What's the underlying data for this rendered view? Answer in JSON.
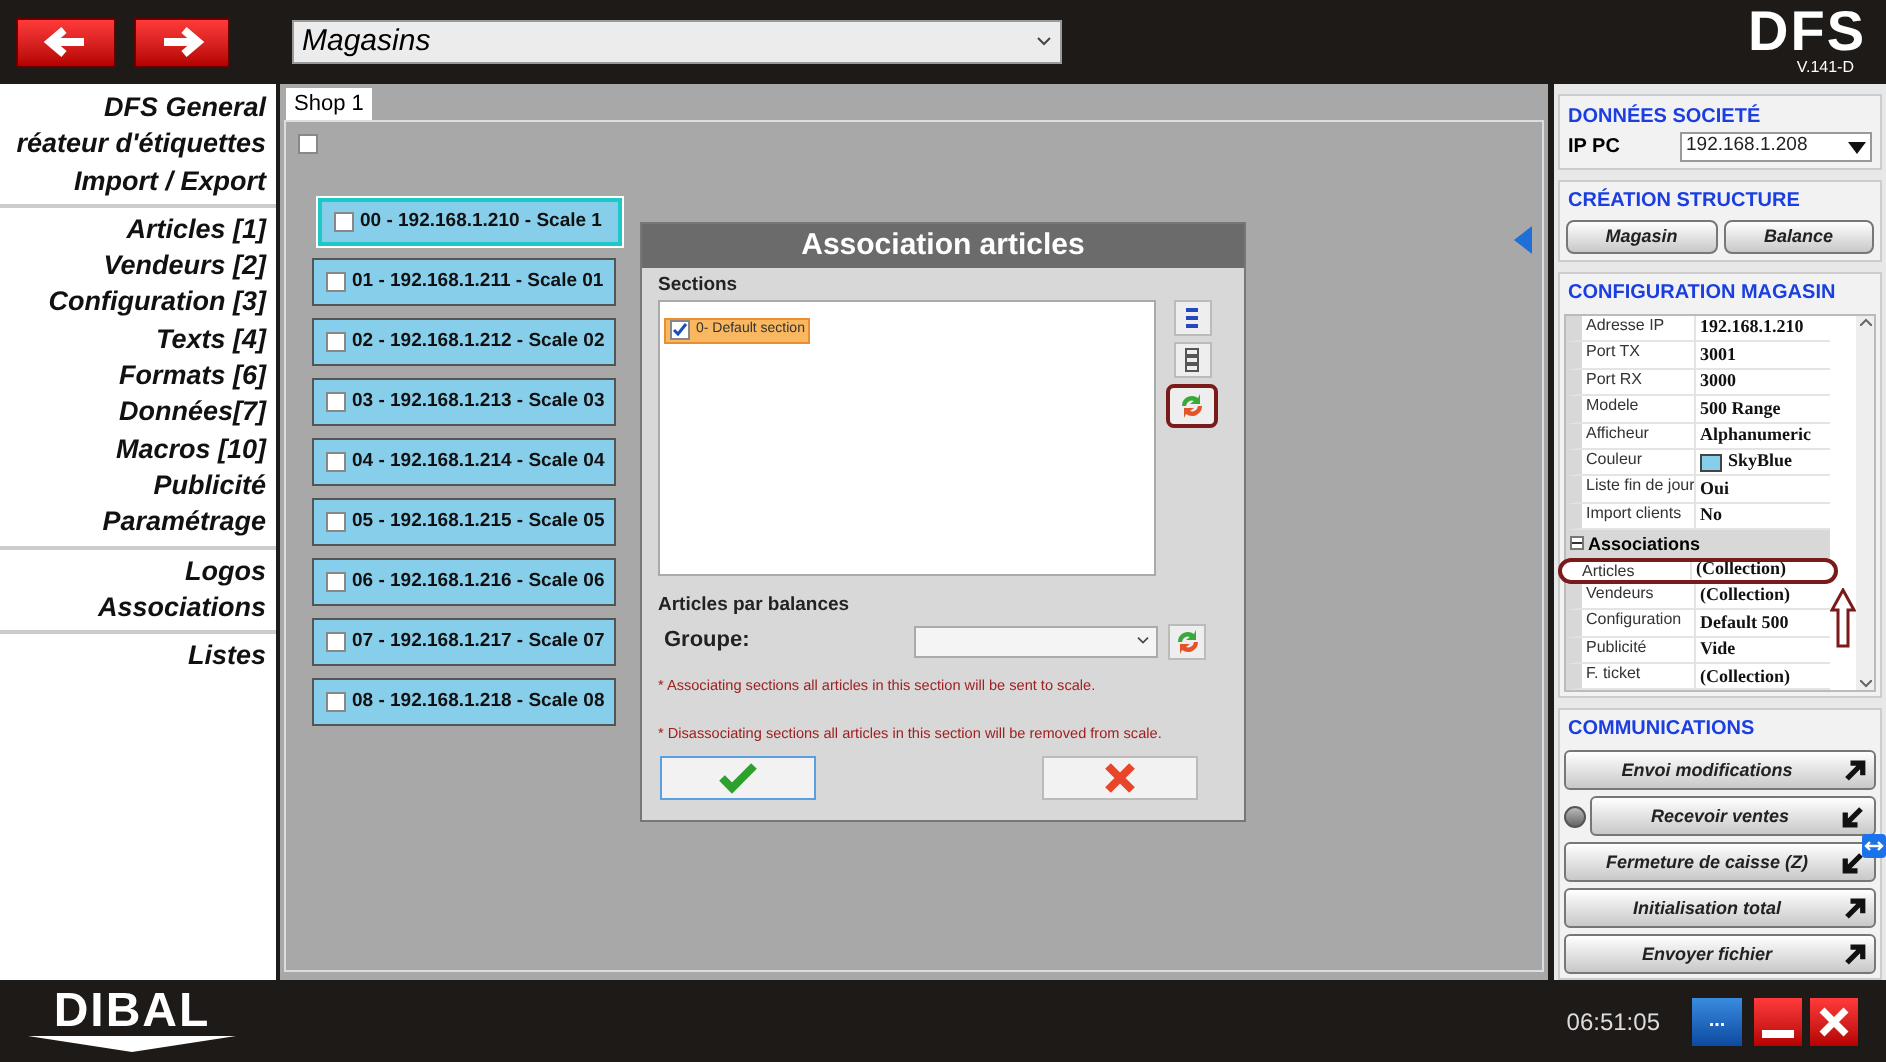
{
  "top_bar": {
    "store_select": {
      "value": "Magasins"
    },
    "logo": "DFS",
    "version": "V.141-D"
  },
  "sidebar": {
    "groups": [
      {
        "items": [
          "DFS General",
          "réateur d'étiquettes",
          "Import / Export"
        ]
      },
      {
        "items": [
          "Articles [1]",
          "Vendeurs [2]",
          "Configuration [3]",
          "Texts [4]",
          "Formats [6]",
          "Données[7]",
          "Macros [10]",
          "Publicité",
          "Paramétrage"
        ]
      },
      {
        "items": [
          "Logos",
          "Associations"
        ]
      },
      {
        "items": [
          "Listes"
        ]
      }
    ]
  },
  "tabs": [
    {
      "label": "Shop 1",
      "selected": true
    }
  ],
  "shop_checkbox": {
    "checked": false
  },
  "scales": [
    {
      "label": "00 - 192.168.1.210 - Scale 1",
      "checked": false,
      "selected": true
    },
    {
      "label": "01 - 192.168.1.211 - Scale 01",
      "checked": false,
      "selected": false
    },
    {
      "label": "02 - 192.168.1.212 - Scale 02",
      "checked": false,
      "selected": false
    },
    {
      "label": "03 - 192.168.1.213 - Scale 03",
      "checked": false,
      "selected": false
    },
    {
      "label": "04 - 192.168.1.214 - Scale 04",
      "checked": false,
      "selected": false
    },
    {
      "label": "05 - 192.168.1.215 - Scale 05",
      "checked": false,
      "selected": false
    },
    {
      "label": "06 - 192.168.1.216 - Scale 06",
      "checked": false,
      "selected": false
    },
    {
      "label": "07 - 192.168.1.217 - Scale 07",
      "checked": false,
      "selected": false
    },
    {
      "label": "08 - 192.168.1.218 - Scale 08",
      "checked": false,
      "selected": false
    }
  ],
  "dialog": {
    "title": "Association articles",
    "sections_label": "Sections",
    "sections": [
      {
        "label": "0- Default section",
        "checked": true
      }
    ],
    "balances_label": "Articles par balances",
    "group_label": "Groupe:",
    "notes": [
      "* Associating sections all articles in this section will be sent to scale.",
      "* Disassociating sections all articles in this section will be removed from scale."
    ]
  },
  "right_panel": {
    "company": {
      "title": "DONNÉES SOCIETÉ",
      "ip_label": "IP PC",
      "ip_value": "192.168.1.208"
    },
    "structure": {
      "title": "CRÉATION STRUCTURE",
      "buttons": [
        "Magasin",
        "Balance"
      ]
    },
    "config": {
      "title": "CONFIGURATION MAGASIN",
      "rows": [
        {
          "kind": "text",
          "label": "Adresse IP",
          "value": "192.168.1.210"
        },
        {
          "kind": "text",
          "label": "Port TX",
          "value": "3001"
        },
        {
          "kind": "text",
          "label": "Port RX",
          "value": "3000"
        },
        {
          "kind": "text",
          "label": "Modele",
          "value": "500 Range"
        },
        {
          "kind": "text",
          "label": "Afficheur",
          "value": "Alphanumeric"
        },
        {
          "kind": "color",
          "label": "Couleur",
          "value": "SkyBlue",
          "color": "#87ceeb"
        },
        {
          "kind": "text",
          "label": "Liste fin de jour",
          "value": "Oui"
        },
        {
          "kind": "text",
          "label": "Import clients",
          "value": "No"
        },
        {
          "kind": "category",
          "label": "Associations",
          "expanded": true
        },
        {
          "kind": "text",
          "label": "Articles",
          "value": "(Collection)",
          "annotated": true
        },
        {
          "kind": "text",
          "label": "Vendeurs",
          "value": "(Collection)"
        },
        {
          "kind": "text",
          "label": "Configuration",
          "value": "Default 500"
        },
        {
          "kind": "text",
          "label": "Publicité",
          "value": "Vide"
        },
        {
          "kind": "text",
          "label": "F. ticket",
          "value": "(Collection)"
        }
      ]
    },
    "communications": {
      "title": "COMMUNICATIONS",
      "buttons": [
        {
          "label": "Envoi modifications",
          "kind": "send",
          "led": false
        },
        {
          "label": "Recevoir ventes",
          "kind": "receive",
          "led": true
        },
        {
          "label": "Fermeture de caisse (Z)",
          "kind": "receive",
          "led": false
        },
        {
          "label": "Initialisation total",
          "kind": "send",
          "led": false
        },
        {
          "label": "Envoyer fichier",
          "kind": "send",
          "led": false
        }
      ]
    }
  },
  "bottom_bar": {
    "logo": "DIBAL",
    "time": "06:51:05",
    "more_button": "..."
  }
}
